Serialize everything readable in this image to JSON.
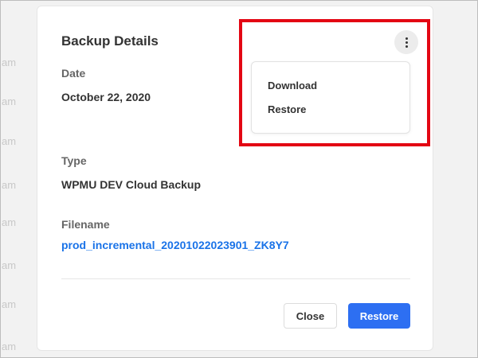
{
  "background": {
    "fragments": [
      "am",
      "am",
      "am",
      "am",
      "am",
      "am",
      "am",
      "am",
      "am"
    ]
  },
  "modal": {
    "title": "Backup Details",
    "date_label": "Date",
    "date_value": "October 22, 2020",
    "type_label": "Type",
    "type_value": "WPMU DEV Cloud Backup",
    "filename_label": "Filename",
    "filename_value": "prod_incremental_20201022023901_ZK8Y7",
    "menu_icon": "kebab-vertical-icon",
    "dropdown": {
      "items": [
        "Download",
        "Restore"
      ]
    },
    "footer": {
      "close_label": "Close",
      "restore_label": "Restore"
    }
  },
  "colors": {
    "accent": "#2d6ff2",
    "link": "#1a73e8",
    "highlight": "#e30613"
  }
}
